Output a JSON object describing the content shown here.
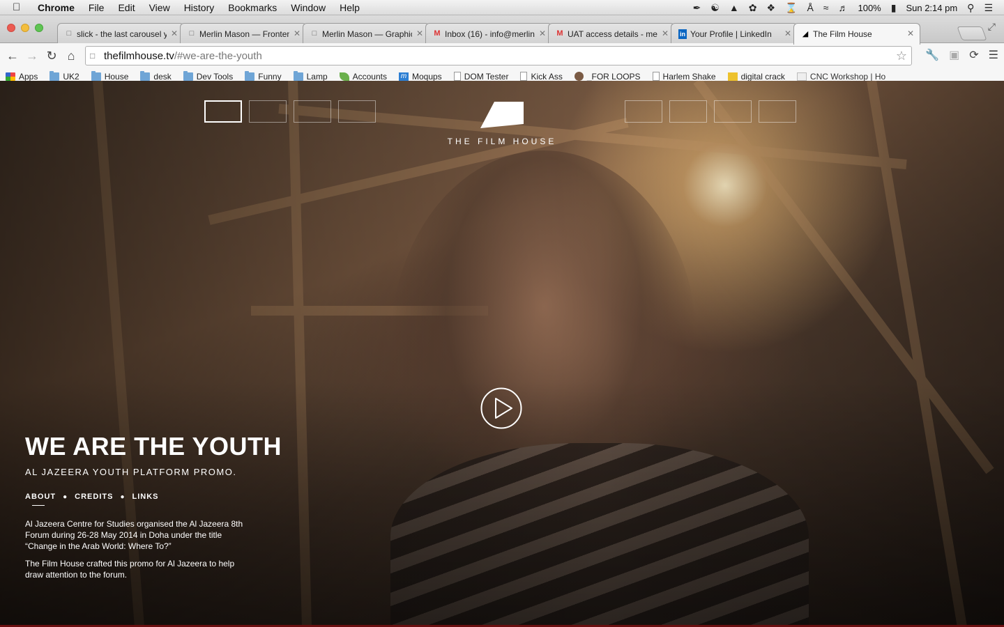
{
  "menubar": {
    "app": "Chrome",
    "items": [
      "File",
      "Edit",
      "View",
      "History",
      "Bookmarks",
      "Window",
      "Help"
    ],
    "battery": "100%",
    "clock": "Sun 2:14 pm"
  },
  "tabs": [
    {
      "title": "slick - the last carousel y",
      "icon": "page-icon"
    },
    {
      "title": "Merlin Mason — Fronten",
      "icon": "page-icon"
    },
    {
      "title": "Merlin Mason — Graphic",
      "icon": "page-icon"
    },
    {
      "title": "Inbox (16) - info@merlin",
      "icon": "gmail-icon"
    },
    {
      "title": "UAT access details - mer",
      "icon": "gmail-icon"
    },
    {
      "title": "Your Profile | LinkedIn",
      "icon": "linkedin-icon"
    },
    {
      "title": "The Film House",
      "icon": "filmhouse-icon"
    }
  ],
  "address_bar": {
    "host": "thefilmhouse.tv",
    "path": "/#we-are-the-youth"
  },
  "bookmarks": [
    {
      "label": "Apps",
      "icon": "apps"
    },
    {
      "label": "UK2",
      "icon": "folder"
    },
    {
      "label": "House",
      "icon": "folder"
    },
    {
      "label": "desk",
      "icon": "folder"
    },
    {
      "label": "Dev Tools",
      "icon": "folder"
    },
    {
      "label": "Funny",
      "icon": "folder"
    },
    {
      "label": "Lamp",
      "icon": "folder"
    },
    {
      "label": "Accounts",
      "icon": "leaf"
    },
    {
      "label": "Moqups",
      "icon": "moqups"
    },
    {
      "label": "DOM Tester",
      "icon": "page"
    },
    {
      "label": "Kick Ass",
      "icon": "page"
    },
    {
      "label": "_FOR LOOPS",
      "icon": "avatar"
    },
    {
      "label": "Harlem Shake",
      "icon": "page"
    },
    {
      "label": "digital crack",
      "icon": "2048"
    },
    {
      "label": "CNC Workshop | Ho",
      "icon": "cnc"
    }
  ],
  "site": {
    "logo_text": "THE FILM HOUSE",
    "active_slide": 1,
    "headline": "WE ARE THE YOUTH",
    "subhead": "AL JAZEERA YOUTH PLATFORM PROMO.",
    "links": [
      "ABOUT",
      "CREDITS",
      "LINKS"
    ],
    "paragraph_1": "Al Jazeera Centre for Studies organised the Al Jazeera 8th Forum during 26-28 May 2014 in Doha under the title “Change in the Arab World: Where To?”",
    "paragraph_2": "The Film House crafted this promo for Al Jazeera to help draw attention to the forum."
  }
}
